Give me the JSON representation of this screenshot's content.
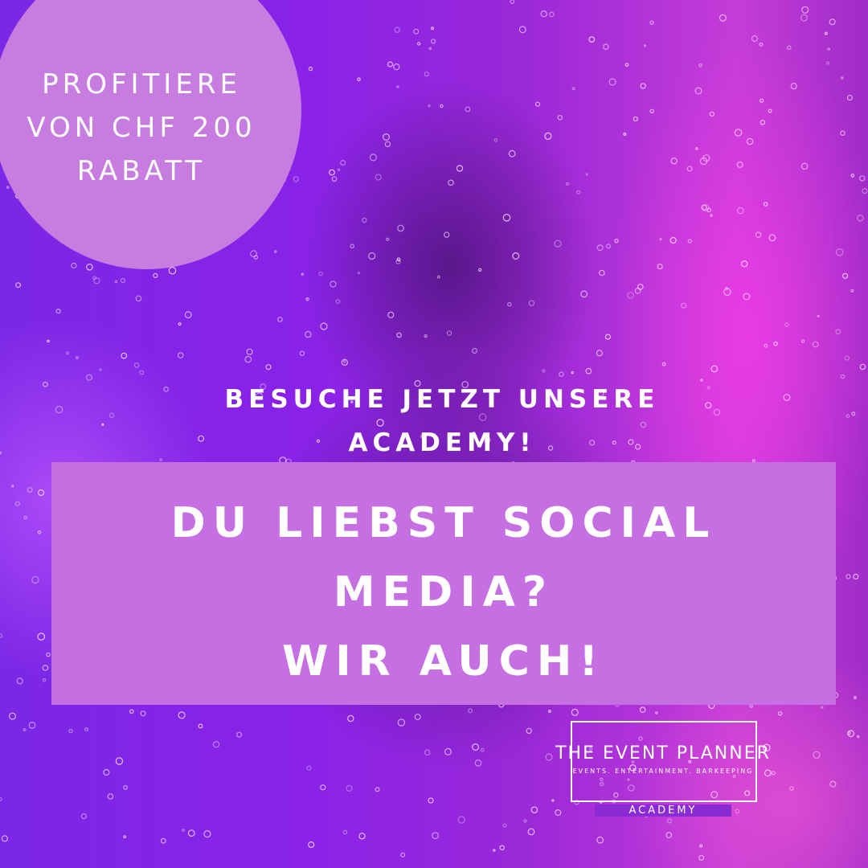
{
  "promo": {
    "lines": [
      "PROFITIERE",
      "VON CHF 200",
      "RABATT"
    ]
  },
  "cta": {
    "lines": [
      "BESUCHE JETZT UNSERE",
      "ACADEMY!"
    ]
  },
  "headline": {
    "lines": [
      "DU LIEBST SOCIAL",
      "MEDIA?",
      "WIR AUCH!"
    ]
  },
  "logo": {
    "name": "THE EVENT PLANNER",
    "tagline": "EVENTS. ENTERTAINMENT. BARKEEPING",
    "sub": "ACADEMY"
  },
  "colors": {
    "accent_panel": "#c56fe2",
    "circle": "#c77de0",
    "text": "#ffffff",
    "background_purple": "#7b27e6",
    "background_magenta": "#e03ce0"
  }
}
